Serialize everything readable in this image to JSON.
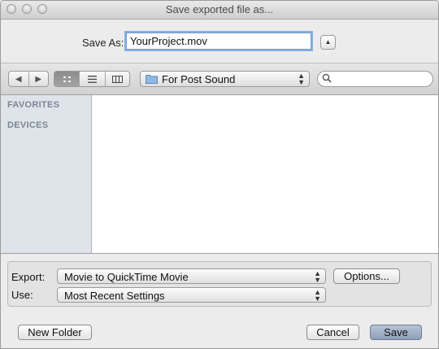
{
  "window": {
    "title": "Save exported file as..."
  },
  "save_as": {
    "label": "Save As:",
    "value": "YourProject.mov"
  },
  "toolbar": {
    "location": "For Post Sound",
    "search_placeholder": ""
  },
  "sidebar": {
    "sections": [
      "FAVORITES",
      "DEVICES"
    ]
  },
  "options_panel": {
    "export_label": "Export:",
    "export_value": "Movie to QuickTime Movie",
    "options_button": "Options...",
    "use_label": "Use:",
    "use_value": "Most Recent Settings"
  },
  "footer": {
    "new_folder": "New Folder",
    "cancel": "Cancel",
    "save": "Save"
  },
  "colors": {
    "focus_ring": "#86b0e6",
    "default_button": "#8e9fb9",
    "sidebar_bg": "#dfe4ea"
  }
}
